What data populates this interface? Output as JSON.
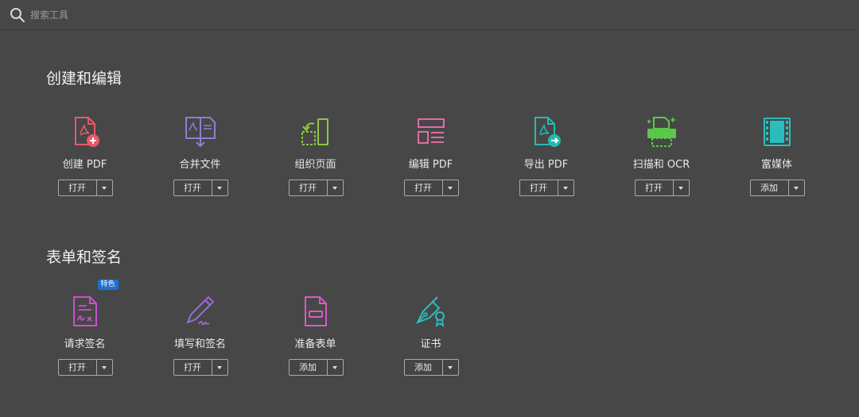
{
  "search": {
    "placeholder": "搜索工具"
  },
  "sections": [
    {
      "title": "创建和编辑"
    },
    {
      "title": "表单和签名"
    }
  ],
  "tools": [
    {
      "label": "创建 PDF",
      "button": "打开",
      "icon": "create-pdf-icon",
      "color": "#e8596b"
    },
    {
      "label": "合并文件",
      "button": "打开",
      "icon": "combine-files-icon",
      "color": "#8b7fd6"
    },
    {
      "label": "组织页面",
      "button": "打开",
      "icon": "organize-pages-icon",
      "color": "#8ec63f"
    },
    {
      "label": "编辑 PDF",
      "button": "打开",
      "icon": "edit-pdf-icon",
      "color": "#e26ba6"
    },
    {
      "label": "导出 PDF",
      "button": "打开",
      "icon": "export-pdf-icon",
      "color": "#27b8b3"
    },
    {
      "label": "扫描和 OCR",
      "button": "打开",
      "icon": "scan-ocr-icon",
      "color": "#5cc84a"
    },
    {
      "label": "富媒体",
      "button": "添加",
      "icon": "rich-media-icon",
      "color": "#2bbdbd"
    },
    {
      "label": "请求签名",
      "button": "打开",
      "icon": "request-signature-icon",
      "color": "#c94fd2",
      "badge": "特色"
    },
    {
      "label": "填写和签名",
      "button": "打开",
      "icon": "fill-sign-icon",
      "color": "#9b6bd6"
    },
    {
      "label": "准备表单",
      "button": "添加",
      "icon": "prepare-form-icon",
      "color": "#d85bc7"
    },
    {
      "label": "证书",
      "button": "添加",
      "icon": "certificates-icon",
      "color": "#2bbdbd"
    }
  ]
}
